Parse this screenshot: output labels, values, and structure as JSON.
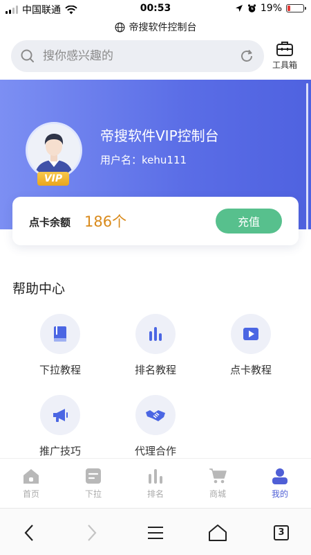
{
  "status_bar": {
    "carrier": "中国联通",
    "time": "00:53",
    "battery": "19%"
  },
  "browser": {
    "url_title": "帝搜软件控制台"
  },
  "search": {
    "placeholder": "搜你感兴趣的"
  },
  "toolbox": {
    "label": "工具箱"
  },
  "profile": {
    "title": "帝搜软件VIP控制台",
    "username_label": "用户名：",
    "username": "kehu111",
    "vip_badge": "VIP"
  },
  "balance": {
    "label": "点卡余额",
    "value": "186个",
    "button": "充值"
  },
  "help": {
    "title": "帮助中心",
    "items": [
      {
        "label": "下拉教程",
        "icon": "book-icon"
      },
      {
        "label": "排名教程",
        "icon": "bar-chart-icon"
      },
      {
        "label": "点卡教程",
        "icon": "video-play-icon"
      },
      {
        "label": "推广技巧",
        "icon": "megaphone-icon"
      },
      {
        "label": "代理合作",
        "icon": "handshake-icon"
      }
    ]
  },
  "tabs": [
    {
      "label": "首页",
      "icon": "home-icon"
    },
    {
      "label": "下拉",
      "icon": "list-icon"
    },
    {
      "label": "排名",
      "icon": "bar-chart-icon"
    },
    {
      "label": "商城",
      "icon": "cart-icon"
    },
    {
      "label": "我的",
      "icon": "user-icon",
      "active": true
    }
  ],
  "browser_nav": {
    "tab_count": "3"
  },
  "colors": {
    "accent": "#4f5fd6",
    "hero_gradient_start": "#7c8ff3",
    "hero_gradient_end": "#4f62e0",
    "recharge": "#57c08d",
    "balance_value": "#d98a1b"
  }
}
